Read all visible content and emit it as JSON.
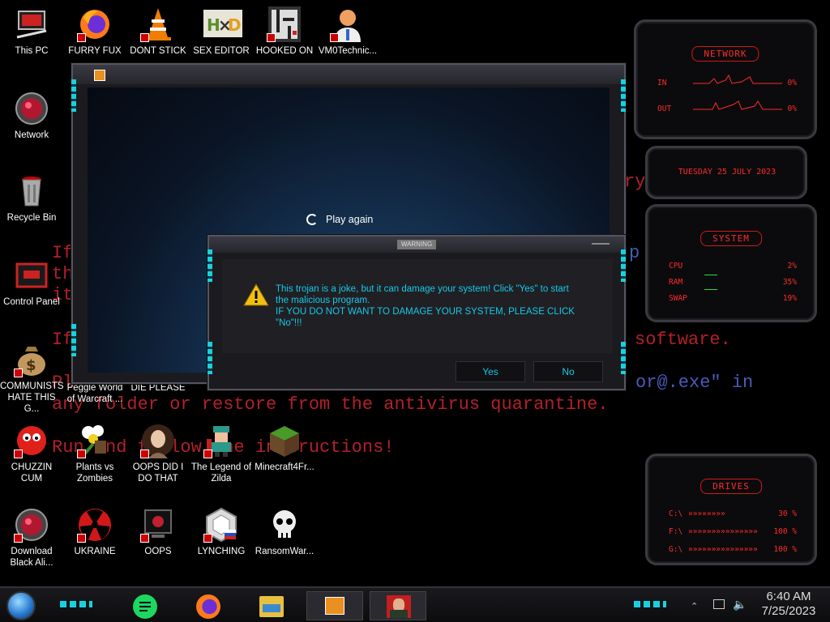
{
  "desktop": {
    "icons": [
      {
        "label": "This PC"
      },
      {
        "label": "FURRY FUX"
      },
      {
        "label": "DONT STICK THIS IN YO..."
      },
      {
        "label": "SEX EDITOR"
      },
      {
        "label": "HOOKED ON AFRICA"
      },
      {
        "label": "VM0Technic..."
      },
      {
        "label": "Network"
      },
      {
        "label": "Recycle Bin"
      },
      {
        "label": "Control Panel"
      },
      {
        "label": "COMMUNISTS HATE THIS G..."
      },
      {
        "label": "Peggle World of Warcraft ..."
      },
      {
        "label": "DIE PLEASE"
      },
      {
        "label": "CHUZZIN CUM"
      },
      {
        "label": "Plants vs Zombies"
      },
      {
        "label": "OOPS DID I DO THAT"
      },
      {
        "label": "The Legend of Zilda"
      },
      {
        "label": "Minecraft4Fr..."
      },
      {
        "label": "Download Black Ali..."
      },
      {
        "label": "UKRAINE"
      },
      {
        "label": "OOPS"
      },
      {
        "label": "LYNCHING"
      },
      {
        "label": "RansomWar..."
      }
    ],
    "background_text": {
      "line1": "If",
      "line2": "the",
      "line3": "it",
      "line4": "If",
      "line5": "Pl",
      "line6": "any folder or restore from the antivirus quarantine.",
      "line7": "Run and follow the instructions!",
      "frag_software": "software.",
      "frag_exe": "or@.exe\" in",
      "frag_ry": "ry",
      "frag_p": "p"
    }
  },
  "media_window": {
    "play_again": "Play again"
  },
  "dialog": {
    "title": "WARNING",
    "message_line1": "This trojan is a joke, but it can damage your system! Click \"Yes\" to start",
    "message_line2": "the malicious program.",
    "message_line3": "IF YOU DO NOT WANT TO DAMAGE YOUR SYSTEM, PLEASE CLICK",
    "message_line4": "\"No\"!!!",
    "yes_label": "Yes",
    "no_label": "No"
  },
  "widgets": {
    "network": {
      "title": "NETWORK",
      "in_label": "IN",
      "in_value": "0%",
      "out_label": "OUT",
      "out_value": "0%"
    },
    "date": {
      "text": "TUESDAY 25 JULY 2023"
    },
    "system": {
      "title": "SYSTEM",
      "cpu_label": "CPU",
      "cpu_value": "2%",
      "ram_label": "RAM",
      "ram_value": "35%",
      "swap_label": "SWAP",
      "swap_value": "19%"
    },
    "drives": {
      "title": "DRIVES",
      "rows": [
        {
          "label": "C:\\",
          "value": "30 %"
        },
        {
          "label": "F:\\",
          "value": "100 %"
        },
        {
          "label": "G:\\",
          "value": "100 %"
        }
      ]
    }
  },
  "taskbar": {
    "time": "6:40 AM",
    "date": "7/25/2023"
  },
  "colors": {
    "accent_cyan": "#19d0e0",
    "widget_red": "#ff2a2a",
    "bg_text_red": "#b3202a",
    "dialog_text": "#16c8e8"
  }
}
